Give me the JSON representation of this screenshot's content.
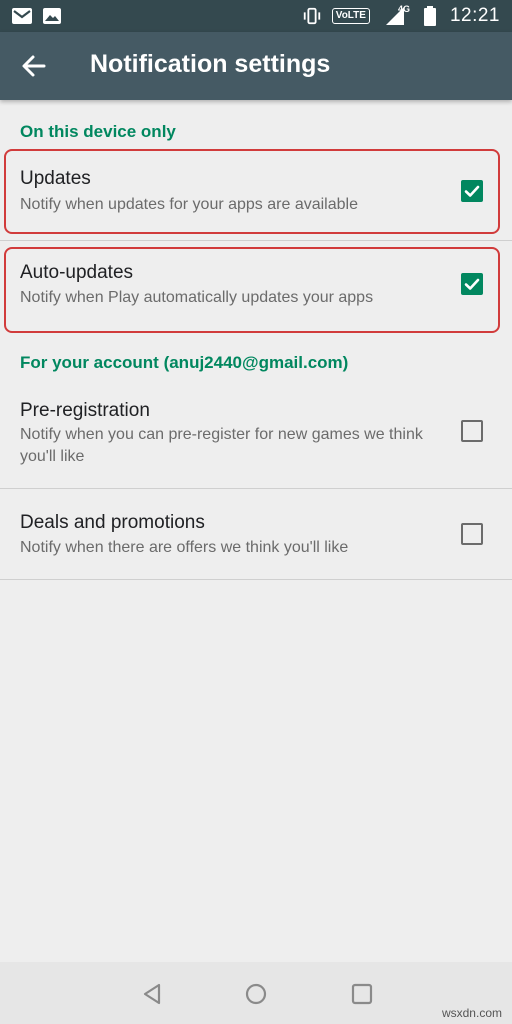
{
  "status_bar": {
    "volte": "VoLTE",
    "network": "4G",
    "time": "12:21",
    "icons": [
      "gmail-icon",
      "photo-icon",
      "vibrate-icon",
      "signal-icon",
      "battery-icon"
    ]
  },
  "app_bar": {
    "title": "Notification settings",
    "back_icon": "back-arrow-icon"
  },
  "sections": [
    {
      "header": "On this device only",
      "items": [
        {
          "title": "Updates",
          "subtitle": "Notify when updates for your apps are available",
          "checked": true
        },
        {
          "title": "Auto-updates",
          "subtitle": "Notify when Play automatically updates your apps",
          "checked": true
        }
      ]
    },
    {
      "header": "For your account (anuj2440@gmail.com)",
      "items": [
        {
          "title": "Pre-registration",
          "subtitle": "Notify when you can pre-register for new games we think you'll like",
          "checked": false
        },
        {
          "title": "Deals and promotions",
          "subtitle": "Notify when there are offers we think you'll like",
          "checked": false
        }
      ]
    }
  ],
  "colors": {
    "accent": "#01875f",
    "app_bar": "#455a64",
    "status_bar": "#34494f",
    "highlight": "#d13b3b"
  },
  "nav_bar": {
    "icons": [
      "back-triangle-icon",
      "home-circle-icon",
      "recents-square-icon"
    ]
  },
  "watermark": "wsxdn.com"
}
